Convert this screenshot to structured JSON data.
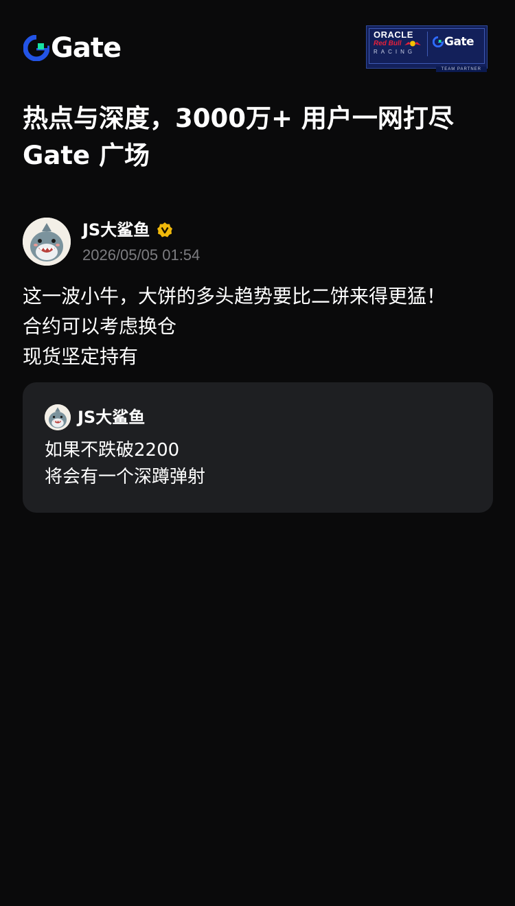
{
  "header": {
    "brand": "Gate",
    "partner_badge": {
      "oracle": "ORACLE",
      "redbull": "Red Bull",
      "racing": "RACING",
      "brand": "Gate",
      "team": "TEAM PARTNER"
    }
  },
  "headline": {
    "line1": "热点与深度，3000万+ 用户一网打尽",
    "line2": "Gate 广场"
  },
  "post": {
    "author": "JS大鲨鱼",
    "timestamp": "2026/05/05 01:54",
    "lines": [
      "这一波小牛，大饼的多头趋势要比二饼来得更猛！",
      "合约可以考虑换仓",
      "现货坚定持有"
    ],
    "quote": {
      "author": "JS大鲨鱼",
      "lines": [
        "如果不跌破2200",
        "将会有一个深蹲弹射"
      ]
    }
  },
  "colors": {
    "background": "#0a0a0b",
    "brand_blue": "#2354e6",
    "brand_green": "#17e3a3",
    "verified": "#f0b90b",
    "card": "#1e1f22",
    "muted_text": "#7c7c80"
  }
}
